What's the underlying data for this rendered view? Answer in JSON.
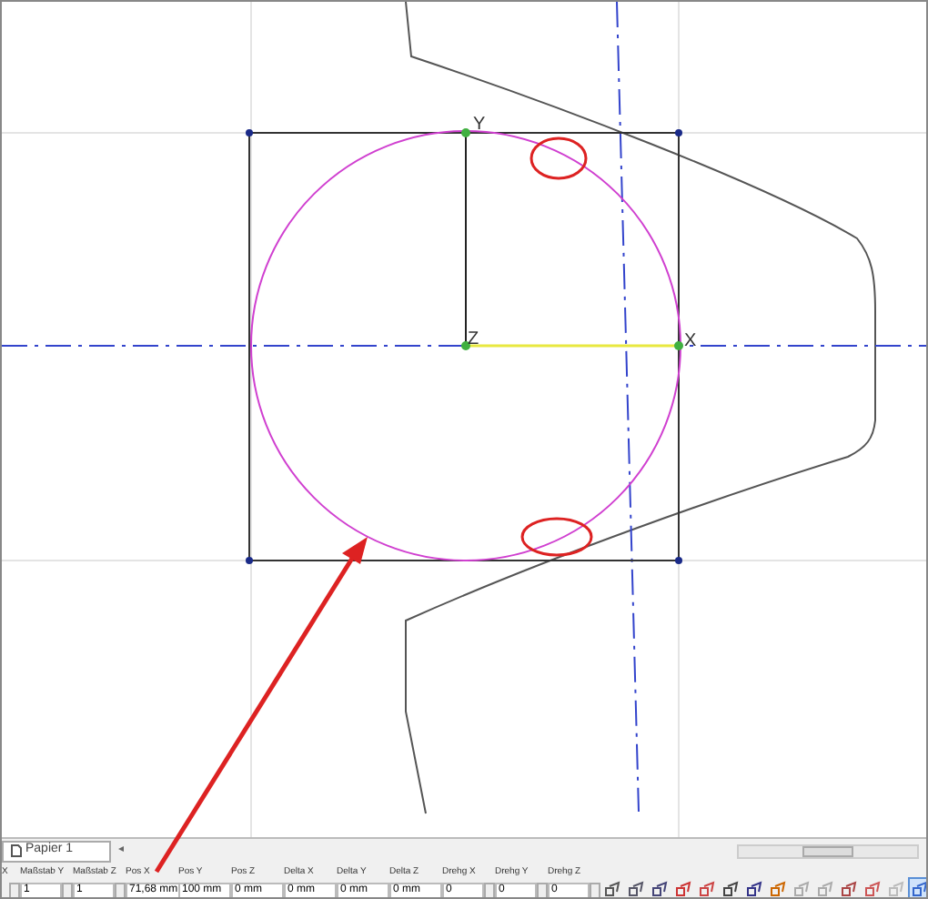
{
  "canvas": {
    "axis_labels": [
      "Y",
      "Z",
      "X"
    ]
  },
  "sheet_tabs": [
    {
      "label": "Papier 1",
      "selected": true
    }
  ],
  "tab_scroll": "◂",
  "properties": [
    {
      "label": "X",
      "spinner": true
    },
    {
      "label": "Maßstab Y",
      "value": "1",
      "spinner": true
    },
    {
      "label": "Maßstab Z",
      "value": "1",
      "spinner": true
    },
    {
      "label": "Pos X",
      "value": "71,68 mm",
      "spinner": false
    },
    {
      "label": "Pos Y",
      "value": "100 mm",
      "spinner": false
    },
    {
      "label": "Pos Z",
      "value": "0 mm",
      "spinner": false
    },
    {
      "label": "Delta X",
      "value": "0 mm",
      "spinner": false
    },
    {
      "label": "Delta Y",
      "value": "0 mm",
      "spinner": false
    },
    {
      "label": "Delta Z",
      "value": "0 mm",
      "spinner": false
    },
    {
      "label": "Drehg X",
      "value": "0",
      "spinner": true
    },
    {
      "label": "Drehg Y",
      "value": "0",
      "spinner": true
    },
    {
      "label": "Drehg Z",
      "value": "0",
      "spinner": true
    }
  ],
  "toolbar": [
    {
      "selected": false
    },
    {
      "selected": false
    },
    {
      "selected": false
    },
    {
      "selected": false
    },
    {
      "selected": false
    },
    {
      "selected": false
    },
    {
      "selected": false
    },
    {
      "selected": false
    },
    {
      "selected": false
    },
    {
      "selected": false
    },
    {
      "selected": false
    },
    {
      "selected": false
    },
    {
      "selected": false
    },
    {
      "selected": true
    }
  ]
}
